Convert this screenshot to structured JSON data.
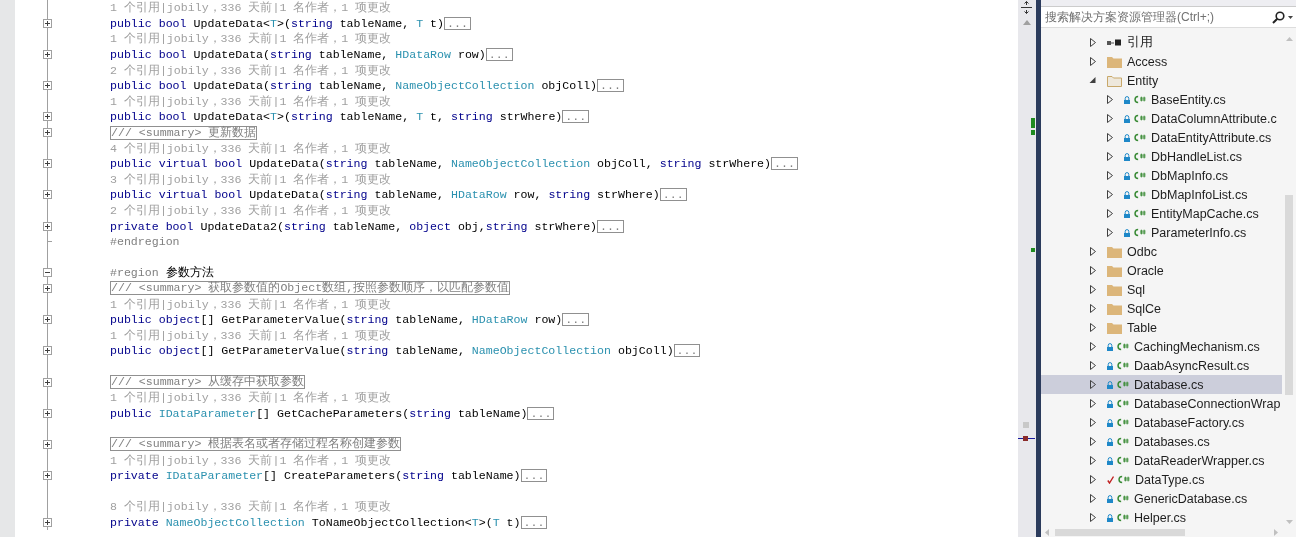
{
  "editor": {
    "lines": [
      {
        "kind": "lens",
        "text": "1 个引用|jobily，336 天前|1 名作者，1 项更改"
      },
      {
        "kind": "code",
        "collapsed": true,
        "tokens": [
          {
            "text": "public",
            "kind": "keyword"
          },
          {
            "text": " bool",
            "kind": "keyword"
          },
          {
            "text": " UpdateData<",
            "kind": "plain"
          },
          {
            "text": "T",
            "kind": "type"
          },
          {
            "text": ">(",
            "kind": "plain"
          },
          {
            "text": "string",
            "kind": "keyword"
          },
          {
            "text": " tableName, ",
            "kind": "plain"
          },
          {
            "text": "T",
            "kind": "type"
          },
          {
            "text": " t)",
            "kind": "plain"
          }
        ],
        "marker": "..."
      },
      {
        "kind": "lens",
        "text": "1 个引用|jobily，336 天前|1 名作者，1 项更改"
      },
      {
        "kind": "code",
        "collapsed": true,
        "tokens": [
          {
            "text": "public",
            "kind": "keyword"
          },
          {
            "text": " bool",
            "kind": "keyword"
          },
          {
            "text": " UpdateData(",
            "kind": "plain"
          },
          {
            "text": "string",
            "kind": "keyword"
          },
          {
            "text": " tableName, ",
            "kind": "plain"
          },
          {
            "text": "HDataRow",
            "kind": "type"
          },
          {
            "text": " row)",
            "kind": "plain"
          }
        ],
        "marker": "..."
      },
      {
        "kind": "lens",
        "text": "2 个引用|jobily，336 天前|1 名作者，1 项更改"
      },
      {
        "kind": "code",
        "collapsed": true,
        "tokens": [
          {
            "text": "public",
            "kind": "keyword"
          },
          {
            "text": " bool",
            "kind": "keyword"
          },
          {
            "text": " UpdateData(",
            "kind": "plain"
          },
          {
            "text": "string",
            "kind": "keyword"
          },
          {
            "text": " tableName, ",
            "kind": "plain"
          },
          {
            "text": "NameObjectCollection",
            "kind": "type"
          },
          {
            "text": " objColl)",
            "kind": "plain"
          }
        ],
        "marker": "..."
      },
      {
        "kind": "lens",
        "text": "1 个引用|jobily，336 天前|1 名作者，1 项更改"
      },
      {
        "kind": "code",
        "collapsed": true,
        "tokens": [
          {
            "text": "public",
            "kind": "keyword"
          },
          {
            "text": " bool",
            "kind": "keyword"
          },
          {
            "text": " UpdateData<",
            "kind": "plain"
          },
          {
            "text": "T",
            "kind": "type"
          },
          {
            "text": ">(",
            "kind": "plain"
          },
          {
            "text": "string",
            "kind": "keyword"
          },
          {
            "text": " tableName, ",
            "kind": "plain"
          },
          {
            "text": "T",
            "kind": "type"
          },
          {
            "text": " t, ",
            "kind": "plain"
          },
          {
            "text": "string",
            "kind": "keyword"
          },
          {
            "text": " strWhere)",
            "kind": "plain"
          }
        ],
        "marker": "..."
      },
      {
        "kind": "summary",
        "collapsed": true,
        "text": "/// <summary> 更新数据"
      },
      {
        "kind": "lens",
        "text": "4 个引用|jobily，336 天前|1 名作者，1 项更改"
      },
      {
        "kind": "code",
        "collapsed": true,
        "tokens": [
          {
            "text": "public",
            "kind": "keyword"
          },
          {
            "text": " virtual",
            "kind": "keyword"
          },
          {
            "text": " bool",
            "kind": "keyword"
          },
          {
            "text": " UpdateData(",
            "kind": "plain"
          },
          {
            "text": "string",
            "kind": "keyword"
          },
          {
            "text": " tableName, ",
            "kind": "plain"
          },
          {
            "text": "NameObjectCollection",
            "kind": "type"
          },
          {
            "text": " objColl, ",
            "kind": "plain"
          },
          {
            "text": "string",
            "kind": "keyword"
          },
          {
            "text": " strWhere)",
            "kind": "plain"
          }
        ],
        "marker": "..."
      },
      {
        "kind": "lens",
        "text": "3 个引用|jobily，336 天前|1 名作者，1 项更改"
      },
      {
        "kind": "code",
        "collapsed": true,
        "tokens": [
          {
            "text": "public",
            "kind": "keyword"
          },
          {
            "text": " virtual",
            "kind": "keyword"
          },
          {
            "text": " bool",
            "kind": "keyword"
          },
          {
            "text": " UpdateData(",
            "kind": "plain"
          },
          {
            "text": "string",
            "kind": "keyword"
          },
          {
            "text": " tableName, ",
            "kind": "plain"
          },
          {
            "text": "HDataRow",
            "kind": "type"
          },
          {
            "text": " row, ",
            "kind": "plain"
          },
          {
            "text": "string",
            "kind": "keyword"
          },
          {
            "text": " strWhere)",
            "kind": "plain"
          }
        ],
        "marker": "..."
      },
      {
        "kind": "lens",
        "text": "2 个引用|jobily，336 天前|1 名作者，1 项更改"
      },
      {
        "kind": "code",
        "collapsed": true,
        "tokens": [
          {
            "text": "private",
            "kind": "keyword"
          },
          {
            "text": " bool",
            "kind": "keyword"
          },
          {
            "text": " UpdateData2(",
            "kind": "plain"
          },
          {
            "text": "string",
            "kind": "keyword"
          },
          {
            "text": " tableName, ",
            "kind": "plain"
          },
          {
            "text": "object",
            "kind": "keyword"
          },
          {
            "text": " obj,",
            "kind": "plain"
          },
          {
            "text": "string",
            "kind": "keyword"
          },
          {
            "text": " strWhere)",
            "kind": "plain"
          }
        ],
        "marker": "..."
      },
      {
        "kind": "code",
        "outline_end": true,
        "tokens": [
          {
            "text": "#endregion",
            "kind": "directive"
          }
        ]
      },
      {
        "kind": "blank"
      },
      {
        "kind": "code",
        "collapsed": false,
        "tokens": [
          {
            "text": "#region",
            "kind": "directive"
          },
          {
            "text": " 参数方法",
            "kind": "plain"
          }
        ]
      },
      {
        "kind": "summary",
        "collapsed": true,
        "text": "/// <summary> 获取参数值的Object数组,按照参数顺序，以匹配参数值"
      },
      {
        "kind": "lens",
        "text": "1 个引用|jobily，336 天前|1 名作者，1 项更改"
      },
      {
        "kind": "code",
        "collapsed": true,
        "tokens": [
          {
            "text": "public",
            "kind": "keyword"
          },
          {
            "text": " object",
            "kind": "keyword"
          },
          {
            "text": "[] GetParameterValue(",
            "kind": "plain"
          },
          {
            "text": "string",
            "kind": "keyword"
          },
          {
            "text": " tableName, ",
            "kind": "plain"
          },
          {
            "text": "HDataRow",
            "kind": "type"
          },
          {
            "text": " row)",
            "kind": "plain"
          }
        ],
        "marker": "..."
      },
      {
        "kind": "lens",
        "text": "1 个引用|jobily，336 天前|1 名作者，1 项更改"
      },
      {
        "kind": "code",
        "collapsed": true,
        "tokens": [
          {
            "text": "public",
            "kind": "keyword"
          },
          {
            "text": " object",
            "kind": "keyword"
          },
          {
            "text": "[] GetParameterValue(",
            "kind": "plain"
          },
          {
            "text": "string",
            "kind": "keyword"
          },
          {
            "text": " tableName, ",
            "kind": "plain"
          },
          {
            "text": "NameObjectCollection",
            "kind": "type"
          },
          {
            "text": " objColl)",
            "kind": "plain"
          }
        ],
        "marker": "..."
      },
      {
        "kind": "blank"
      },
      {
        "kind": "summary",
        "collapsed": true,
        "text": "/// <summary> 从缓存中获取参数"
      },
      {
        "kind": "lens",
        "text": "1 个引用|jobily，336 天前|1 名作者，1 项更改"
      },
      {
        "kind": "code",
        "collapsed": true,
        "tokens": [
          {
            "text": "public",
            "kind": "keyword"
          },
          {
            "text": " IDataParameter",
            "kind": "type"
          },
          {
            "text": "[] GetCacheParameters(",
            "kind": "plain"
          },
          {
            "text": "string",
            "kind": "keyword"
          },
          {
            "text": " tableName)",
            "kind": "plain"
          }
        ],
        "marker": "..."
      },
      {
        "kind": "blank"
      },
      {
        "kind": "summary",
        "collapsed": true,
        "text": "/// <summary> 根据表名或者存储过程名称创建参数"
      },
      {
        "kind": "lens",
        "text": "1 个引用|jobily，336 天前|1 名作者，1 项更改"
      },
      {
        "kind": "code",
        "collapsed": true,
        "tokens": [
          {
            "text": "private",
            "kind": "keyword"
          },
          {
            "text": " IDataParameter",
            "kind": "type"
          },
          {
            "text": "[] CreateParameters(",
            "kind": "plain"
          },
          {
            "text": "string",
            "kind": "keyword"
          },
          {
            "text": " tableName)",
            "kind": "plain"
          }
        ],
        "marker": "..."
      },
      {
        "kind": "blank"
      },
      {
        "kind": "lens",
        "text": "8 个引用|jobily，336 天前|1 名作者，1 项更改"
      },
      {
        "kind": "code",
        "collapsed": true,
        "tokens": [
          {
            "text": "private",
            "kind": "keyword"
          },
          {
            "text": " NameObjectCollection",
            "kind": "type"
          },
          {
            "text": " ToNameObjectCollection<",
            "kind": "plain"
          },
          {
            "text": "T",
            "kind": "type"
          },
          {
            "text": ">(",
            "kind": "plain"
          },
          {
            "text": "T",
            "kind": "type"
          },
          {
            "text": " t)",
            "kind": "plain"
          }
        ],
        "marker": "..."
      }
    ]
  },
  "solution_explorer": {
    "search": {
      "placeholder": "搜索解决方案资源管理器(Ctrl+;)"
    },
    "items": [
      {
        "label": "引用",
        "kind": "references",
        "expanded": false,
        "selected": false
      },
      {
        "label": "Access",
        "kind": "folder",
        "expanded": false,
        "selected": false
      },
      {
        "label": "Entity",
        "kind": "folder",
        "expanded": true,
        "selected": false,
        "children": [
          {
            "label": "BaseEntity.cs",
            "kind": "csharp",
            "expanded": false,
            "selected": false,
            "pending_edit": false
          },
          {
            "label": "DataColumnAttribute.c",
            "kind": "csharp",
            "expanded": false,
            "selected": false,
            "pending_edit": false
          },
          {
            "label": "DataEntityAttribute.cs",
            "kind": "csharp",
            "expanded": false,
            "selected": false,
            "pending_edit": false
          },
          {
            "label": "DbHandleList.cs",
            "kind": "csharp",
            "expanded": false,
            "selected": false,
            "pending_edit": false
          },
          {
            "label": "DbMapInfo.cs",
            "kind": "csharp",
            "expanded": false,
            "selected": false,
            "pending_edit": false
          },
          {
            "label": "DbMapInfoList.cs",
            "kind": "csharp",
            "expanded": false,
            "selected": false,
            "pending_edit": false
          },
          {
            "label": "EntityMapCache.cs",
            "kind": "csharp",
            "expanded": false,
            "selected": false,
            "pending_edit": false
          },
          {
            "label": "ParameterInfo.cs",
            "kind": "csharp",
            "expanded": false,
            "selected": false,
            "pending_edit": false
          }
        ]
      },
      {
        "label": "Odbc",
        "kind": "folder",
        "expanded": false,
        "selected": false
      },
      {
        "label": "Oracle",
        "kind": "folder",
        "expanded": false,
        "selected": false
      },
      {
        "label": "Sql",
        "kind": "folder",
        "expanded": false,
        "selected": false
      },
      {
        "label": "SqlCe",
        "kind": "folder",
        "expanded": false,
        "selected": false
      },
      {
        "label": "Table",
        "kind": "folder",
        "expanded": false,
        "selected": false
      },
      {
        "label": "CachingMechanism.cs",
        "kind": "csharp",
        "expanded": false,
        "selected": false,
        "pending_edit": false
      },
      {
        "label": "DaabAsyncResult.cs",
        "kind": "csharp",
        "expanded": false,
        "selected": false,
        "pending_edit": false
      },
      {
        "label": "Database.cs",
        "kind": "csharp",
        "expanded": false,
        "selected": true,
        "pending_edit": false
      },
      {
        "label": "DatabaseConnectionWrap",
        "kind": "csharp",
        "expanded": false,
        "selected": false,
        "pending_edit": false
      },
      {
        "label": "DatabaseFactory.cs",
        "kind": "csharp",
        "expanded": false,
        "selected": false,
        "pending_edit": false
      },
      {
        "label": "Databases.cs",
        "kind": "csharp",
        "expanded": false,
        "selected": false,
        "pending_edit": false
      },
      {
        "label": "DataReaderWrapper.cs",
        "kind": "csharp",
        "expanded": false,
        "selected": false,
        "pending_edit": false
      },
      {
        "label": "DataType.cs",
        "kind": "csharp",
        "expanded": false,
        "selected": false,
        "pending_edit": true
      },
      {
        "label": "GenericDatabase.cs",
        "kind": "csharp",
        "expanded": false,
        "selected": false,
        "pending_edit": false
      },
      {
        "label": "Helper.cs",
        "kind": "csharp",
        "expanded": false,
        "selected": false,
        "pending_edit": false
      }
    ]
  }
}
